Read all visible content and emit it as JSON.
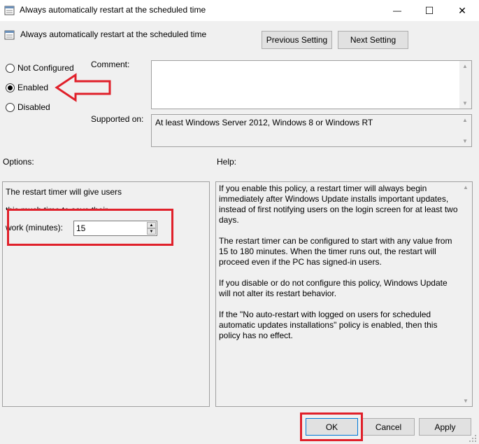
{
  "window": {
    "title": "Always automatically restart at the scheduled time",
    "controls": {
      "minimize": "—",
      "maximize": "☐",
      "close": "✕"
    }
  },
  "header": {
    "policy_name": "Always automatically restart at the scheduled time",
    "prev_label": "Previous Setting",
    "next_label": "Next Setting"
  },
  "state": {
    "options": [
      {
        "label": "Not Configured",
        "selected": false
      },
      {
        "label": "Enabled",
        "selected": true
      },
      {
        "label": "Disabled",
        "selected": false
      }
    ]
  },
  "comment": {
    "label": "Comment:",
    "value": ""
  },
  "supported": {
    "label": "Supported on:",
    "value": "At least Windows Server 2012, Windows 8 or Windows RT"
  },
  "options_panel": {
    "heading": "Options:",
    "line1": "The restart timer will give users",
    "line2": "this much time to save their",
    "field_label": "work (minutes):",
    "field_value": "15"
  },
  "help_panel": {
    "heading": "Help:",
    "paragraphs": [
      "If you enable this policy, a restart timer will always begin immediately after Windows Update installs important updates, instead of first notifying users on the login screen for at least two days.",
      "The restart timer can be configured to start with any value from 15 to 180 minutes. When the timer runs out, the restart will proceed even if the PC has signed-in users.",
      "If you disable or do not configure this policy, Windows Update will not alter its restart behavior.",
      "If the \"No auto-restart with logged on users for scheduled automatic updates installations\" policy is enabled, then this policy has no effect."
    ]
  },
  "footer": {
    "ok_label": "OK",
    "cancel_label": "Cancel",
    "apply_label": "Apply"
  },
  "colors": {
    "annotation": "#e0202a",
    "accent": "#0078d7"
  }
}
